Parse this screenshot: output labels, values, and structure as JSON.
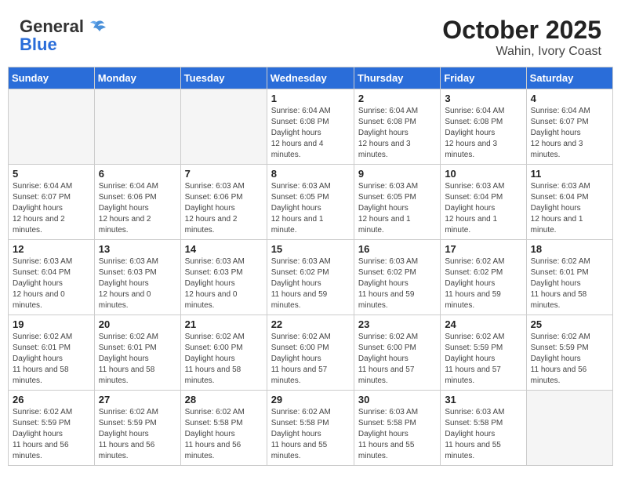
{
  "header": {
    "logo_general": "General",
    "logo_blue": "Blue",
    "month": "October 2025",
    "location": "Wahin, Ivory Coast"
  },
  "weekdays": [
    "Sunday",
    "Monday",
    "Tuesday",
    "Wednesday",
    "Thursday",
    "Friday",
    "Saturday"
  ],
  "weeks": [
    [
      {
        "day": "",
        "empty": true
      },
      {
        "day": "",
        "empty": true
      },
      {
        "day": "",
        "empty": true
      },
      {
        "day": "1",
        "sunrise": "6:04 AM",
        "sunset": "6:08 PM",
        "daylight": "12 hours and 4 minutes."
      },
      {
        "day": "2",
        "sunrise": "6:04 AM",
        "sunset": "6:08 PM",
        "daylight": "12 hours and 3 minutes."
      },
      {
        "day": "3",
        "sunrise": "6:04 AM",
        "sunset": "6:08 PM",
        "daylight": "12 hours and 3 minutes."
      },
      {
        "day": "4",
        "sunrise": "6:04 AM",
        "sunset": "6:07 PM",
        "daylight": "12 hours and 3 minutes."
      }
    ],
    [
      {
        "day": "5",
        "sunrise": "6:04 AM",
        "sunset": "6:07 PM",
        "daylight": "12 hours and 2 minutes."
      },
      {
        "day": "6",
        "sunrise": "6:04 AM",
        "sunset": "6:06 PM",
        "daylight": "12 hours and 2 minutes."
      },
      {
        "day": "7",
        "sunrise": "6:03 AM",
        "sunset": "6:06 PM",
        "daylight": "12 hours and 2 minutes."
      },
      {
        "day": "8",
        "sunrise": "6:03 AM",
        "sunset": "6:05 PM",
        "daylight": "12 hours and 1 minute."
      },
      {
        "day": "9",
        "sunrise": "6:03 AM",
        "sunset": "6:05 PM",
        "daylight": "12 hours and 1 minute."
      },
      {
        "day": "10",
        "sunrise": "6:03 AM",
        "sunset": "6:04 PM",
        "daylight": "12 hours and 1 minute."
      },
      {
        "day": "11",
        "sunrise": "6:03 AM",
        "sunset": "6:04 PM",
        "daylight": "12 hours and 1 minute."
      }
    ],
    [
      {
        "day": "12",
        "sunrise": "6:03 AM",
        "sunset": "6:04 PM",
        "daylight": "12 hours and 0 minutes."
      },
      {
        "day": "13",
        "sunrise": "6:03 AM",
        "sunset": "6:03 PM",
        "daylight": "12 hours and 0 minutes."
      },
      {
        "day": "14",
        "sunrise": "6:03 AM",
        "sunset": "6:03 PM",
        "daylight": "12 hours and 0 minutes."
      },
      {
        "day": "15",
        "sunrise": "6:03 AM",
        "sunset": "6:02 PM",
        "daylight": "11 hours and 59 minutes."
      },
      {
        "day": "16",
        "sunrise": "6:03 AM",
        "sunset": "6:02 PM",
        "daylight": "11 hours and 59 minutes."
      },
      {
        "day": "17",
        "sunrise": "6:02 AM",
        "sunset": "6:02 PM",
        "daylight": "11 hours and 59 minutes."
      },
      {
        "day": "18",
        "sunrise": "6:02 AM",
        "sunset": "6:01 PM",
        "daylight": "11 hours and 58 minutes."
      }
    ],
    [
      {
        "day": "19",
        "sunrise": "6:02 AM",
        "sunset": "6:01 PM",
        "daylight": "11 hours and 58 minutes."
      },
      {
        "day": "20",
        "sunrise": "6:02 AM",
        "sunset": "6:01 PM",
        "daylight": "11 hours and 58 minutes."
      },
      {
        "day": "21",
        "sunrise": "6:02 AM",
        "sunset": "6:00 PM",
        "daylight": "11 hours and 58 minutes."
      },
      {
        "day": "22",
        "sunrise": "6:02 AM",
        "sunset": "6:00 PM",
        "daylight": "11 hours and 57 minutes."
      },
      {
        "day": "23",
        "sunrise": "6:02 AM",
        "sunset": "6:00 PM",
        "daylight": "11 hours and 57 minutes."
      },
      {
        "day": "24",
        "sunrise": "6:02 AM",
        "sunset": "5:59 PM",
        "daylight": "11 hours and 57 minutes."
      },
      {
        "day": "25",
        "sunrise": "6:02 AM",
        "sunset": "5:59 PM",
        "daylight": "11 hours and 56 minutes."
      }
    ],
    [
      {
        "day": "26",
        "sunrise": "6:02 AM",
        "sunset": "5:59 PM",
        "daylight": "11 hours and 56 minutes."
      },
      {
        "day": "27",
        "sunrise": "6:02 AM",
        "sunset": "5:59 PM",
        "daylight": "11 hours and 56 minutes."
      },
      {
        "day": "28",
        "sunrise": "6:02 AM",
        "sunset": "5:58 PM",
        "daylight": "11 hours and 56 minutes."
      },
      {
        "day": "29",
        "sunrise": "6:02 AM",
        "sunset": "5:58 PM",
        "daylight": "11 hours and 55 minutes."
      },
      {
        "day": "30",
        "sunrise": "6:03 AM",
        "sunset": "5:58 PM",
        "daylight": "11 hours and 55 minutes."
      },
      {
        "day": "31",
        "sunrise": "6:03 AM",
        "sunset": "5:58 PM",
        "daylight": "11 hours and 55 minutes."
      },
      {
        "day": "",
        "empty": true
      }
    ]
  ]
}
